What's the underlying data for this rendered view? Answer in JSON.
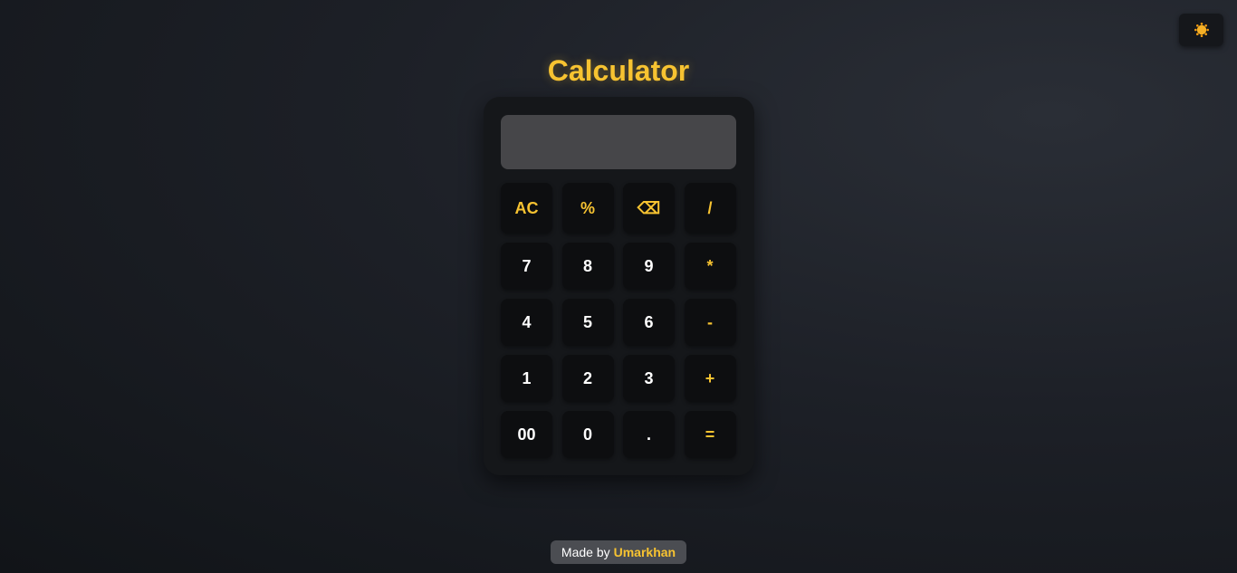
{
  "theme_toggle": {
    "icon": "sun-icon"
  },
  "title": "Calculator",
  "display": {
    "value": ""
  },
  "keys": [
    {
      "label": "AC",
      "type": "op",
      "name": "clear-button"
    },
    {
      "label": "%",
      "type": "op",
      "name": "percent-button"
    },
    {
      "label": "⌫",
      "type": "op",
      "name": "backspace-button"
    },
    {
      "label": "/",
      "type": "op",
      "name": "divide-button"
    },
    {
      "label": "7",
      "type": "num",
      "name": "digit-7-button"
    },
    {
      "label": "8",
      "type": "num",
      "name": "digit-8-button"
    },
    {
      "label": "9",
      "type": "num",
      "name": "digit-9-button"
    },
    {
      "label": "*",
      "type": "op",
      "name": "multiply-button"
    },
    {
      "label": "4",
      "type": "num",
      "name": "digit-4-button"
    },
    {
      "label": "5",
      "type": "num",
      "name": "digit-5-button"
    },
    {
      "label": "6",
      "type": "num",
      "name": "digit-6-button"
    },
    {
      "label": "-",
      "type": "op",
      "name": "subtract-button"
    },
    {
      "label": "1",
      "type": "num",
      "name": "digit-1-button"
    },
    {
      "label": "2",
      "type": "num",
      "name": "digit-2-button"
    },
    {
      "label": "3",
      "type": "num",
      "name": "digit-3-button"
    },
    {
      "label": "+",
      "type": "op",
      "name": "add-button"
    },
    {
      "label": "00",
      "type": "num",
      "name": "double-zero-button"
    },
    {
      "label": "0",
      "type": "num",
      "name": "digit-0-button"
    },
    {
      "label": ".",
      "type": "num",
      "name": "decimal-button"
    },
    {
      "label": "=",
      "type": "op",
      "name": "equals-button"
    }
  ],
  "footer": {
    "prefix": "Made by",
    "author": "Umarkhan"
  },
  "colors": {
    "accent": "#f7c331",
    "key_bg": "#0d0e10",
    "display_bg": "#464649",
    "body_bg": "#15171a"
  }
}
